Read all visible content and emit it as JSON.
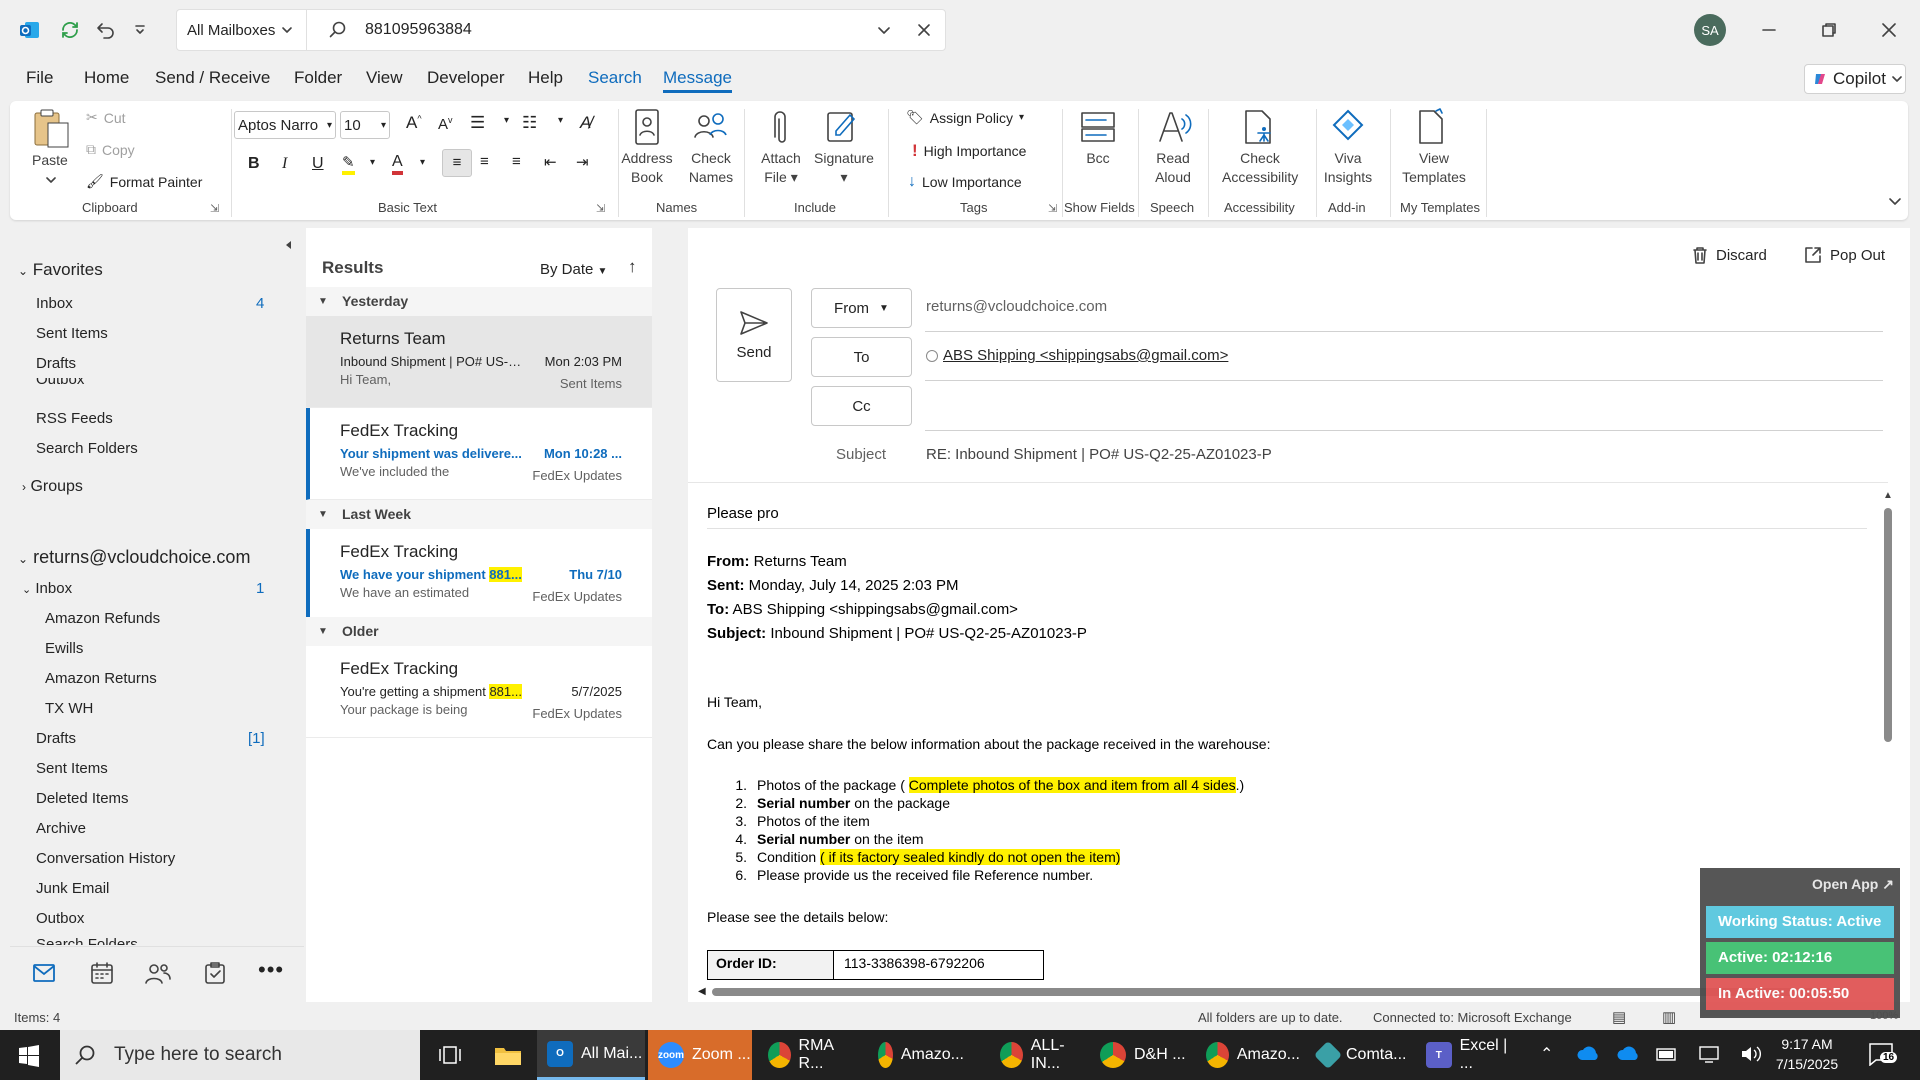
{
  "titlebar": {
    "mailbox": "All Mailboxes",
    "search_value": "881095963884",
    "avatar": "SA"
  },
  "menu": {
    "file": "File",
    "home": "Home",
    "send_receive": "Send / Receive",
    "folder": "Folder",
    "view": "View",
    "developer": "Developer",
    "help": "Help",
    "search": "Search",
    "message": "Message",
    "copilot": "Copilot"
  },
  "ribbon": {
    "paste": "Paste",
    "cut": "Cut",
    "copy": "Copy",
    "format_painter": "Format Painter",
    "clipboard": "Clipboard",
    "font_name": "Aptos Narro",
    "font_size": "10",
    "basic_text": "Basic Text",
    "address": "Address",
    "book": "Book",
    "check": "Check",
    "names": "Names",
    "names_group": "Names",
    "attach": "Attach",
    "file": "File",
    "signature": "Signature",
    "include": "Include",
    "assign_policy": "Assign Policy",
    "high_importance": "High Importance",
    "low_importance": "Low Importance",
    "tags": "Tags",
    "bcc": "Bcc",
    "show_fields": "Show Fields",
    "read": "Read",
    "aloud": "Aloud",
    "speech": "Speech",
    "check2": "Check",
    "accessibility": "Accessibility",
    "accessibility_group": "Accessibility",
    "viva": "Viva",
    "insights": "Insights",
    "addin": "Add-in",
    "view": "View",
    "templates": "Templates",
    "my_templates": "My Templates"
  },
  "folders": {
    "favorites": "Favorites",
    "inbox": "Inbox",
    "inbox_count": "4",
    "sent": "Sent Items",
    "drafts": "Drafts",
    "outbox_cut": "Outbox",
    "rss": "RSS Feeds",
    "search_folders": "Search Folders",
    "groups": "Groups",
    "account": "returns@vcloudchoice.com",
    "acc_inbox": "Inbox",
    "acc_inbox_count": "1",
    "amazon_refunds": "Amazon Refunds",
    "ewills": "Ewills",
    "amazon_returns": "Amazon Returns",
    "tx_wh": "TX WH",
    "acc_drafts": "Drafts",
    "acc_drafts_count": "[1]",
    "acc_sent": "Sent Items",
    "deleted": "Deleted Items",
    "archive": "Archive",
    "conv_history": "Conversation History",
    "junk": "Junk Email",
    "outbox": "Outbox",
    "search_cut": "Search Folders"
  },
  "list": {
    "results": "Results",
    "sort": "By Date",
    "groups": {
      "yesterday": "Yesterday",
      "last_week": "Last Week",
      "older": "Older"
    },
    "messages": [
      {
        "sender": "Returns Team",
        "subject": "Inbound Shipment | PO# US-Q...",
        "date": "Mon 2:03 PM",
        "preview": "Hi Team,",
        "folder": "Sent Items"
      },
      {
        "sender": "FedEx Tracking",
        "subject": "Your shipment was delivere...",
        "date": "Mon 10:28 ...",
        "preview": "We've included the",
        "folder": "FedEx Updates"
      },
      {
        "sender": "FedEx Tracking",
        "subject_a": "We have your shipment ",
        "subject_b": "881...",
        "date": "Thu 7/10",
        "preview": "We have an estimated",
        "folder": "FedEx Updates"
      },
      {
        "sender": "FedEx Tracking",
        "subject_a": "You're getting a shipment ",
        "subject_b": "881...",
        "date": "5/7/2025",
        "preview": "Your package is being",
        "folder": "FedEx Updates"
      }
    ]
  },
  "compose": {
    "discard": "Discard",
    "popout": "Pop Out",
    "send": "Send",
    "from_btn": "From",
    "from_value": "returns@vcloudchoice.com",
    "to_btn": "To",
    "to_value": "ABS Shipping <shippingsabs@gmail.com>",
    "cc_btn": "Cc",
    "subject_label": "Subject",
    "subject_value": "RE: Inbound Shipment | PO# US-Q2-25-AZ01023-P"
  },
  "body": {
    "line1": "Please pro",
    "from_l": "From:",
    "from_v": " Returns Team",
    "sent_l": "Sent:",
    "sent_v": " Monday, July 14, 2025 2:03 PM",
    "to_l": "To:",
    "to_v": " ABS Shipping <shippingsabs@gmail.com>",
    "subj_l": "Subject:",
    "subj_v": " Inbound Shipment | PO# US-Q2-25-AZ01023-P",
    "greet": "Hi Team,",
    "ask": "Can you please share the below information about the package received in the warehouse:",
    "items": [
      {
        "n": "1.",
        "a": "Photos of the package ( ",
        "h": "Complete photos of the box and item from all 4 sides",
        "b": ".)"
      },
      {
        "n": "2.",
        "bold": "Serial number",
        "rest": " on the package"
      },
      {
        "n": "3.",
        "a": "Photos of the item"
      },
      {
        "n": "4.",
        "bold": "Serial number",
        "rest": " on the item"
      },
      {
        "n": "5.",
        "a": "Condition ",
        "h": "( if its factory sealed kindly do not open the item)"
      },
      {
        "n": "6.",
        "a": "Please provide us the received file Reference number."
      }
    ],
    "details": "Please see the details below:",
    "order_l": "Order ID:",
    "order_v": "113-3386398-6792206"
  },
  "widget": {
    "open_app": "Open App ↗",
    "working": "Working Status: Active",
    "active": "Active: 02:12:16",
    "inactive": "In Active: 00:05:50"
  },
  "status": {
    "items": "Items: 4",
    "uptodate": "All folders are up to date.",
    "connected": "Connected to: Microsoft Exchange",
    "zoom": "100%"
  },
  "taskbar": {
    "search": "Type here to search",
    "apps": [
      {
        "label": "All Mai...",
        "color": "#0f6cbd",
        "glyph": "O"
      },
      {
        "label": "Zoom ...",
        "color": "#2d8cff",
        "glyph": "zoom"
      },
      {
        "label": "RMA R...",
        "color": "#db4437",
        "glyph": ""
      },
      {
        "label": "Amazo...",
        "color": "#db4437",
        "glyph": ""
      },
      {
        "label": "ALL-IN...",
        "color": "#db4437",
        "glyph": ""
      },
      {
        "label": "D&H ...",
        "color": "#db4437",
        "glyph": ""
      },
      {
        "label": "Amazo...",
        "color": "#db4437",
        "glyph": ""
      },
      {
        "label": "Comta...",
        "color": "#3aa0a6",
        "glyph": ""
      },
      {
        "label": "Excel | ...",
        "color": "#5b5fc7",
        "glyph": "T"
      }
    ],
    "time": "9:17 AM",
    "date": "7/15/2025",
    "notif": "16"
  },
  "colors": {
    "accent": "#0f6cbd",
    "highlight": "#fff100",
    "widget_green": "#3fbf6f",
    "widget_red": "#e05555"
  }
}
